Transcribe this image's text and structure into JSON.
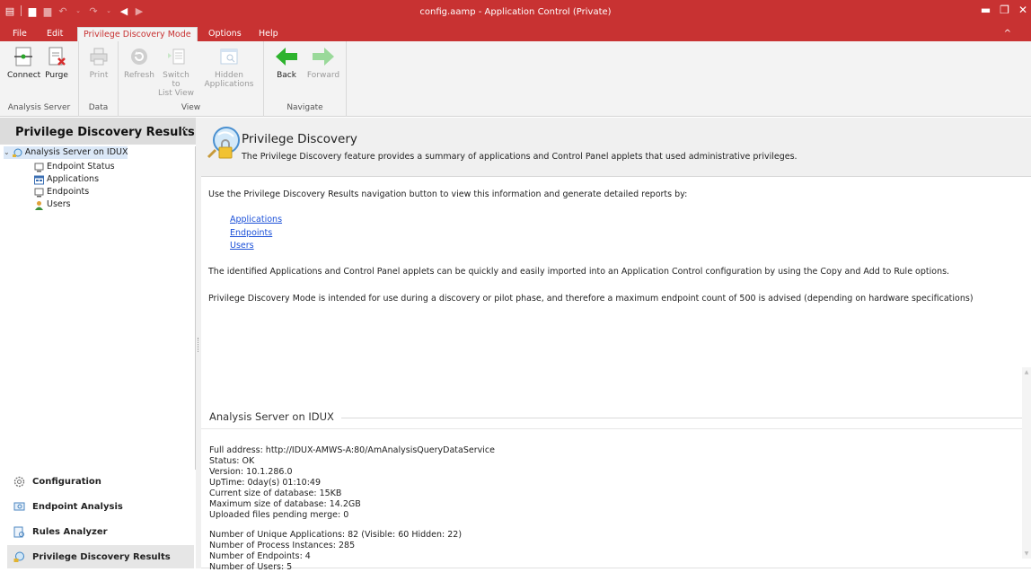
{
  "window": {
    "title": "config.aamp - Application Control (Private)"
  },
  "menu": {
    "tabs": [
      "File",
      "Edit",
      "Privilege Discovery Mode",
      "Options",
      "Help"
    ],
    "active_tab": "Privilege Discovery Mode"
  },
  "ribbon": {
    "groups": [
      {
        "label": "Analysis Server",
        "buttons": [
          "Connect",
          "Purge"
        ]
      },
      {
        "label": "Data",
        "buttons": [
          "Print"
        ]
      },
      {
        "label": "View",
        "buttons": [
          "Refresh",
          "Switch to List View",
          "Hidden Applications"
        ]
      },
      {
        "label": "Navigate",
        "buttons": [
          "Back",
          "Forward"
        ]
      }
    ],
    "connect": "Connect",
    "purge": "Purge",
    "print": "Print",
    "refresh": "Refresh",
    "switch_l1": "Switch to",
    "switch_l2": "List View",
    "hidden_l1": "Hidden",
    "hidden_l2": "Applications",
    "back": "Back",
    "forward": "Forward",
    "group_analysis": "Analysis Server",
    "group_data": "Data",
    "group_view": "View",
    "group_navigate": "Navigate"
  },
  "nav": {
    "header": "Privilege Discovery Results",
    "tree": {
      "root": "Analysis Server on IDUX",
      "children": [
        "Endpoint Status",
        "Applications",
        "Endpoints",
        "Users"
      ]
    },
    "sections": [
      "Configuration",
      "Endpoint Analysis",
      "Rules Analyzer",
      "Privilege Discovery Results"
    ],
    "active_section": "Privilege Discovery Results"
  },
  "main": {
    "title": "Privilege Discovery",
    "subtitle": "The Privilege Discovery feature provides a summary of applications and Control Panel applets that used administrative privileges.",
    "intro": "Use the Privilege Discovery Results navigation button to view this information and generate detailed reports by:",
    "links": [
      "Applications",
      "Endpoints",
      "Users"
    ],
    "para1": "The identified Applications and Control Panel applets can be quickly and easily imported into an Application Control configuration by using the Copy and Add to Rule options.",
    "para2": "Privilege Discovery Mode is intended for use during a discovery or pilot phase, and therefore a maximum endpoint count of 500 is advised (depending on hardware specifications)",
    "server_heading": "Analysis Server on IDUX",
    "server_info": [
      "Full address: http://IDUX-AMWS-A:80/AmAnalysisQueryDataService",
      "Status: OK",
      "Version: 10.1.286.0",
      "UpTime: 0day(s) 01:10:49",
      "Current size of database: 15KB",
      "Maximum size of database: 14.2GB",
      "Uploaded files pending merge: 0"
    ],
    "stats": [
      "Number of Unique Applications: 82  (Visible: 60 Hidden: 22)",
      "Number of Process Instances: 285",
      "Number of Endpoints: 4",
      "Number of Users: 5"
    ]
  },
  "colors": {
    "title_bar": "#c83232",
    "ribbon_bg": "#f3f3f3",
    "link": "#1a4fd8",
    "nav_header_bg": "#dcdcdc",
    "tree_selected": "#dbe8f7",
    "arrow_green": "#2db32d"
  }
}
